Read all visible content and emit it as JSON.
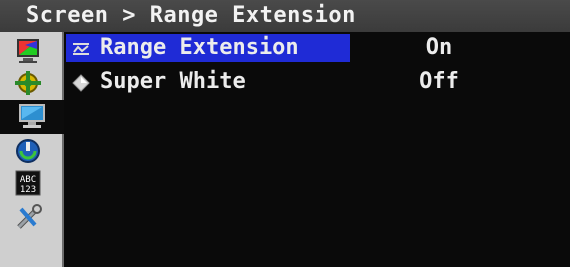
{
  "header": {
    "breadcrumb": "Screen > Range Extension"
  },
  "sidebar": {
    "items": [
      {
        "icon": "color-adjust-icon"
      },
      {
        "icon": "signal-input-icon"
      },
      {
        "icon": "screen-monitor-icon",
        "active": true
      },
      {
        "icon": "power-eco-icon"
      },
      {
        "icon": "language-abc-icon"
      },
      {
        "icon": "tools-wrench-icon"
      }
    ]
  },
  "menu": {
    "items": [
      {
        "label": "Range Extension",
        "value": "On",
        "selected": true
      },
      {
        "label": "Super White",
        "value": "Off",
        "selected": false
      }
    ]
  },
  "colors": {
    "selection": "#1f2bd6",
    "header_bg": "#444444",
    "sidebar_bg": "#cfcfcf",
    "panel_bg": "#0a0a0a",
    "text": "#ececec"
  }
}
